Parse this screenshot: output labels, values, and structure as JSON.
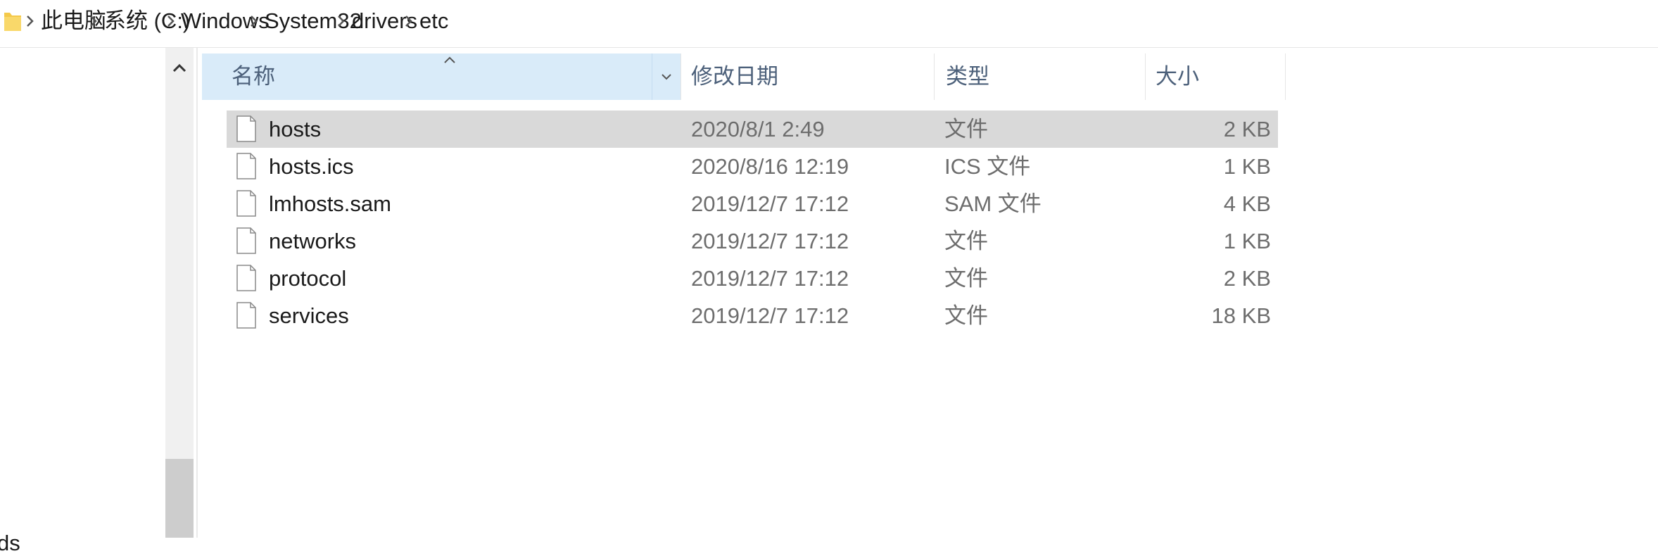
{
  "breadcrumb": [
    "此电脑",
    "系统 (C:)",
    "Windows",
    "System32",
    "drivers",
    "etc"
  ],
  "columns": {
    "name": "名称",
    "date": "修改日期",
    "type": "类型",
    "size": "大小"
  },
  "files": [
    {
      "name": "hosts",
      "date": "2020/8/1 2:49",
      "type": "文件",
      "size": "2 KB",
      "selected": true
    },
    {
      "name": "hosts.ics",
      "date": "2020/8/16 12:19",
      "type": "ICS 文件",
      "size": "1 KB"
    },
    {
      "name": "lmhosts.sam",
      "date": "2019/12/7 17:12",
      "type": "SAM 文件",
      "size": "4 KB"
    },
    {
      "name": "networks",
      "date": "2019/12/7 17:12",
      "type": "文件",
      "size": "1 KB"
    },
    {
      "name": "protocol",
      "date": "2019/12/7 17:12",
      "type": "文件",
      "size": "2 KB"
    },
    {
      "name": "services",
      "date": "2019/12/7 17:12",
      "type": "文件",
      "size": "18 KB"
    }
  ],
  "nav_partial_label": "ds",
  "icons": {
    "folder": "folder-icon",
    "file": "file-icon",
    "separator": "chevron-right-icon",
    "sort": "sort-ascending-icon",
    "scroll_up": "scroll-up-icon",
    "dropdown": "chevron-down-icon"
  },
  "colors": {
    "header_bg": "#d9ebf9",
    "selected_row_bg": "#d9d9d9",
    "header_text": "#4c607a",
    "folder": "#f4c94a"
  }
}
